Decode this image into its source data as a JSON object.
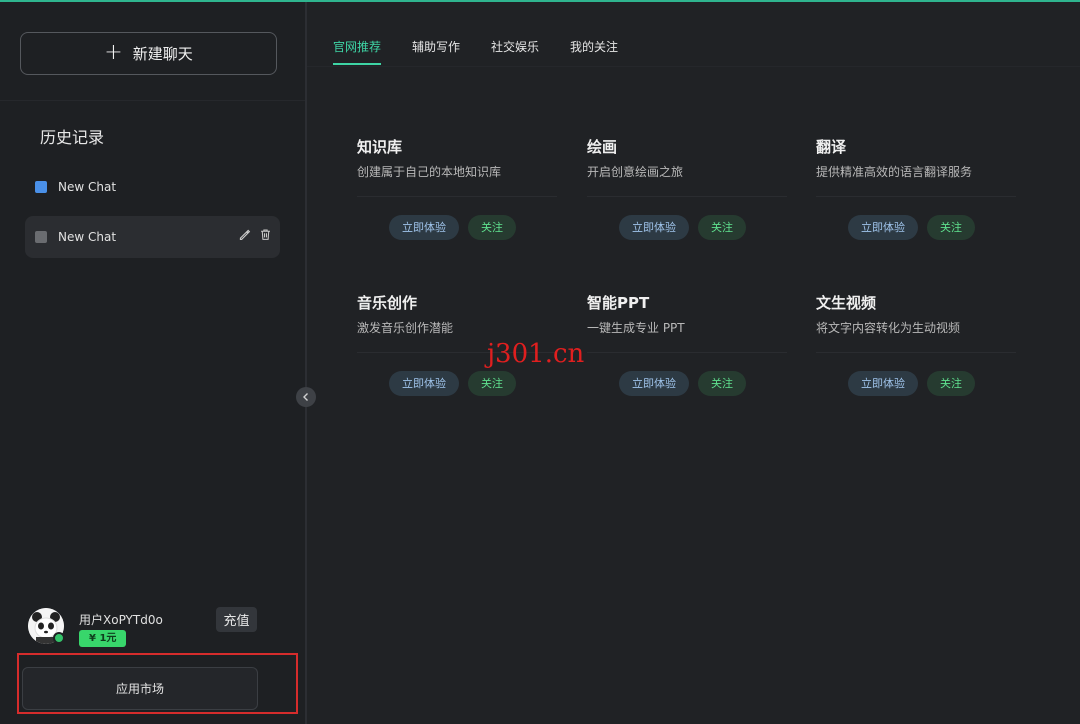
{
  "sidebar": {
    "new_chat_label": "新建聊天",
    "history_title": "历史记录",
    "chats": [
      {
        "label": "New Chat",
        "color": "#4a90e8"
      },
      {
        "label": "New Chat",
        "color": "#6a6c70"
      }
    ],
    "user": {
      "name": "用户XoPYTd0o",
      "balance": "¥ 1元",
      "recharge_label": "充值"
    },
    "market_label": "应用市场"
  },
  "tabs": [
    "官网推荐",
    "辅助写作",
    "社交娱乐",
    "我的关注"
  ],
  "active_tab": "官网推荐",
  "cards": [
    {
      "title": "知识库",
      "desc": "创建属于自己的本地知识库",
      "try": "立即体验",
      "follow": "关注"
    },
    {
      "title": "绘画",
      "desc": "开启创意绘画之旅",
      "try": "立即体验",
      "follow": "关注"
    },
    {
      "title": "翻译",
      "desc": "提供精准高效的语言翻译服务",
      "try": "立即体验",
      "follow": "关注"
    },
    {
      "title": "音乐创作",
      "desc": "激发音乐创作潜能",
      "try": "立即体验",
      "follow": "关注"
    },
    {
      "title": "智能PPT",
      "desc": "一键生成专业 PPT",
      "try": "立即体验",
      "follow": "关注"
    },
    {
      "title": "文生视频",
      "desc": "将文字内容转化为生动视频",
      "try": "立即体验",
      "follow": "关注"
    }
  ],
  "watermark": "j301.cn",
  "colors": {
    "accent": "#3ed5a5",
    "background": "#202225",
    "highlight_frame": "#d62c2c"
  }
}
